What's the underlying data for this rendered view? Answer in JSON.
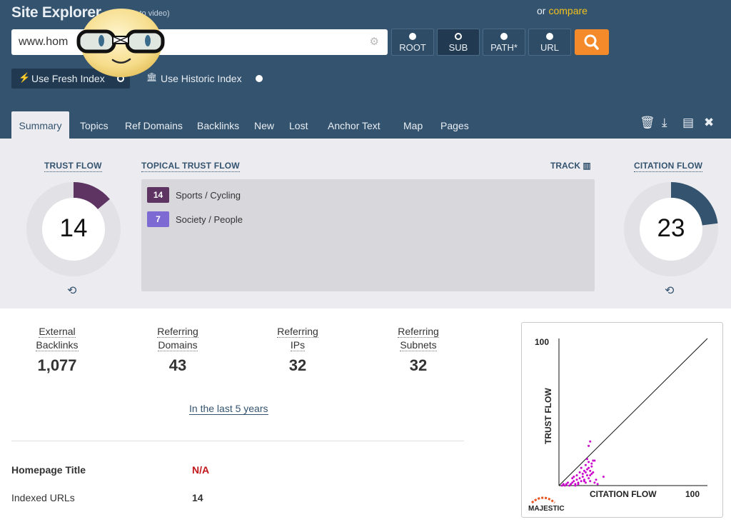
{
  "header": {
    "title": "Site Explorer",
    "how_video": "(how-to video)",
    "or": "or",
    "compare": "compare",
    "url_value": "www.hom"
  },
  "modes": [
    {
      "label": "ROOT",
      "active": false
    },
    {
      "label": "SUB",
      "active": true
    },
    {
      "label": "PATH*",
      "active": false
    },
    {
      "label": "URL",
      "active": false
    }
  ],
  "index": {
    "fresh_label": "Use Fresh Index",
    "historic_label": "Use Historic Index"
  },
  "tabs": [
    "Summary",
    "Topics",
    "Ref Domains",
    "Backlinks",
    "New",
    "Lost",
    "Anchor Text",
    "Map",
    "Pages"
  ],
  "metrics": {
    "trust_flow_title": "TRUST FLOW",
    "trust_flow": 14,
    "citation_flow_title": "CITATION FLOW",
    "citation_flow": 23,
    "topical_title": "TOPICAL TRUST FLOW",
    "track_label": "TRACK",
    "topics": [
      {
        "value": "14",
        "label": "Sports / Cycling",
        "color": "#5e3463"
      },
      {
        "value": "7",
        "label": "Society / People",
        "color": "#7d6ad3"
      }
    ],
    "colors": {
      "trust": "#5e3463",
      "citation": "#34536f"
    }
  },
  "stats": [
    {
      "line1": "External",
      "line2": "Backlinks",
      "value": "1,077"
    },
    {
      "line1": "Referring",
      "line2": "Domains",
      "value": "43"
    },
    {
      "line1": "Referring",
      "line2": "IPs",
      "value": "32"
    },
    {
      "line1": "Referring",
      "line2": "Subnets",
      "value": "32"
    }
  ],
  "last_years_link": "In the last 5 years",
  "info": {
    "homepage_title_label": "Homepage Title",
    "homepage_title_value": "N/A",
    "indexed_urls_label": "Indexed URLs",
    "indexed_urls_value": "14"
  },
  "chart_data": {
    "type": "scatter",
    "xlabel": "CITATION FLOW",
    "ylabel": "TRUST FLOW",
    "xlim": [
      0,
      100
    ],
    "ylim": [
      0,
      100
    ],
    "x_tick_label": "100",
    "y_tick_label": "100",
    "logo": "MAJESTIC",
    "diagonal": true,
    "color": "#cc00cc",
    "points": [
      [
        2,
        0
      ],
      [
        3,
        1
      ],
      [
        4,
        0
      ],
      [
        5,
        1
      ],
      [
        6,
        2
      ],
      [
        7,
        0
      ],
      [
        8,
        1
      ],
      [
        9,
        2
      ],
      [
        10,
        3
      ],
      [
        11,
        1
      ],
      [
        12,
        4
      ],
      [
        13,
        2
      ],
      [
        14,
        5
      ],
      [
        15,
        3
      ],
      [
        16,
        6
      ],
      [
        17,
        4
      ],
      [
        18,
        2
      ],
      [
        19,
        7
      ],
      [
        20,
        5
      ],
      [
        21,
        3
      ],
      [
        22,
        8
      ],
      [
        16,
        8
      ],
      [
        17,
        10
      ],
      [
        18,
        9
      ],
      [
        19,
        11
      ],
      [
        20,
        12
      ],
      [
        21,
        10
      ],
      [
        22,
        13
      ],
      [
        15,
        12
      ],
      [
        18,
        14
      ],
      [
        20,
        16
      ],
      [
        22,
        15
      ],
      [
        24,
        17
      ],
      [
        19,
        18
      ],
      [
        21,
        7
      ],
      [
        23,
        9
      ],
      [
        25,
        4
      ],
      [
        24,
        2
      ],
      [
        26,
        1
      ],
      [
        12,
        7
      ],
      [
        14,
        9
      ],
      [
        13,
        1
      ],
      [
        10,
        6
      ],
      [
        9,
        5
      ],
      [
        30,
        6
      ],
      [
        21,
        30
      ],
      [
        23,
        17
      ],
      [
        20,
        27
      ],
      [
        17,
        3
      ],
      [
        11,
        0
      ]
    ]
  }
}
